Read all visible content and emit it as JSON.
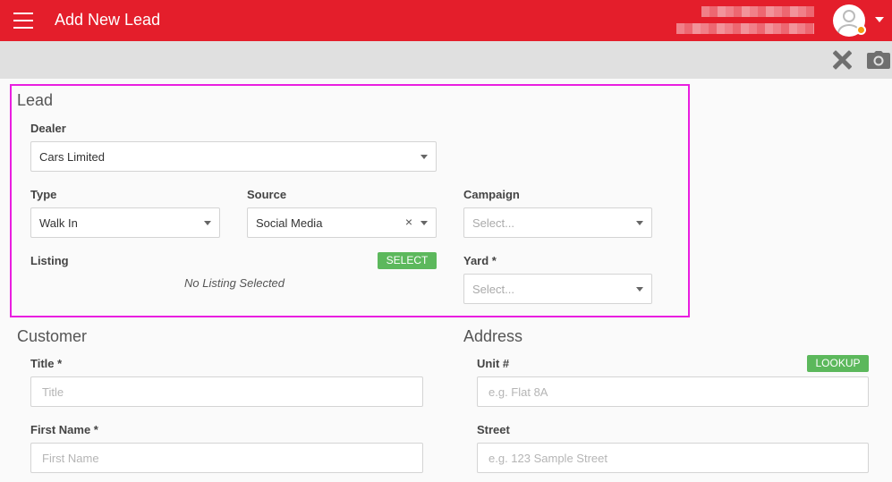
{
  "header": {
    "title": "Add New Lead",
    "menu_icon": "hamburger-menu-icon",
    "user_icon": "user-avatar-icon",
    "accent_color": "#e41e2b",
    "status_dot_color": "#f39c12"
  },
  "toolbar": {
    "close_icon": "close-icon",
    "camera_icon": "camera-icon"
  },
  "lead": {
    "heading": "Lead",
    "dealer": {
      "label": "Dealer",
      "value": "Cars Limited"
    },
    "type": {
      "label": "Type",
      "value": "Walk In"
    },
    "source": {
      "label": "Source",
      "value": "Social Media",
      "clear_symbol": "×"
    },
    "campaign": {
      "label": "Campaign",
      "placeholder": "Select..."
    },
    "listing": {
      "label": "Listing",
      "button": "SELECT",
      "empty_text": "No Listing Selected"
    },
    "yard": {
      "label": "Yard *",
      "placeholder": "Select..."
    }
  },
  "customer": {
    "heading": "Customer",
    "title": {
      "label": "Title *",
      "placeholder": "Title"
    },
    "first_name": {
      "label": "First Name *",
      "placeholder": "First Name"
    }
  },
  "address": {
    "heading": "Address",
    "unit": {
      "label": "Unit #",
      "placeholder": "e.g. Flat 8A",
      "button": "LOOKUP"
    },
    "street": {
      "label": "Street",
      "placeholder": "e.g. 123 Sample Street"
    }
  }
}
